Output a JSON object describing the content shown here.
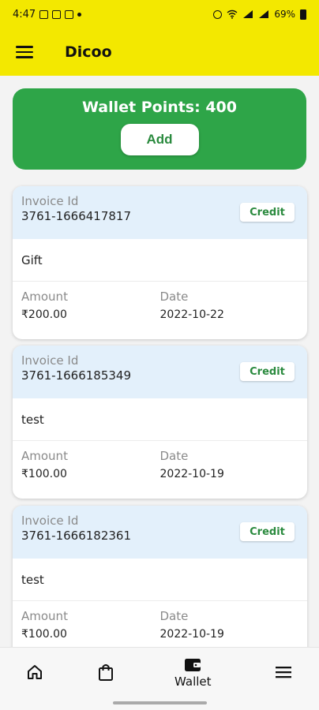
{
  "status_bar": {
    "time": "4:47",
    "battery": "69%"
  },
  "app": {
    "title": "Dicoo"
  },
  "wallet": {
    "points_text": "Wallet Points: 400",
    "add_label": "Add"
  },
  "transactions": [
    {
      "invoice_label": "Invoice Id",
      "invoice_id": "3761-1666417817",
      "type": "Credit",
      "description": "Gift",
      "amount_label": "Amount",
      "amount": "₹200.00",
      "date_label": "Date",
      "date": "2022-10-22"
    },
    {
      "invoice_label": "Invoice Id",
      "invoice_id": "3761-1666185349",
      "type": "Credit",
      "description": "test",
      "amount_label": "Amount",
      "amount": "₹100.00",
      "date_label": "Date",
      "date": "2022-10-19"
    },
    {
      "invoice_label": "Invoice Id",
      "invoice_id": "3761-1666182361",
      "type": "Credit",
      "description": "test",
      "amount_label": "Amount",
      "amount": "₹100.00",
      "date_label": "Date",
      "date": "2022-10-19"
    }
  ],
  "bottom_nav": {
    "items": [
      {
        "icon": "home-icon",
        "label": ""
      },
      {
        "icon": "shopping-bag-icon",
        "label": ""
      },
      {
        "icon": "wallet-icon",
        "label": "Wallet"
      },
      {
        "icon": "menu-icon",
        "label": ""
      }
    ]
  },
  "colors": {
    "brand_yellow": "#f3e800",
    "wallet_green": "#2ea548",
    "credit_green": "#2a8a3e",
    "card_header": "#e3f0fb"
  }
}
